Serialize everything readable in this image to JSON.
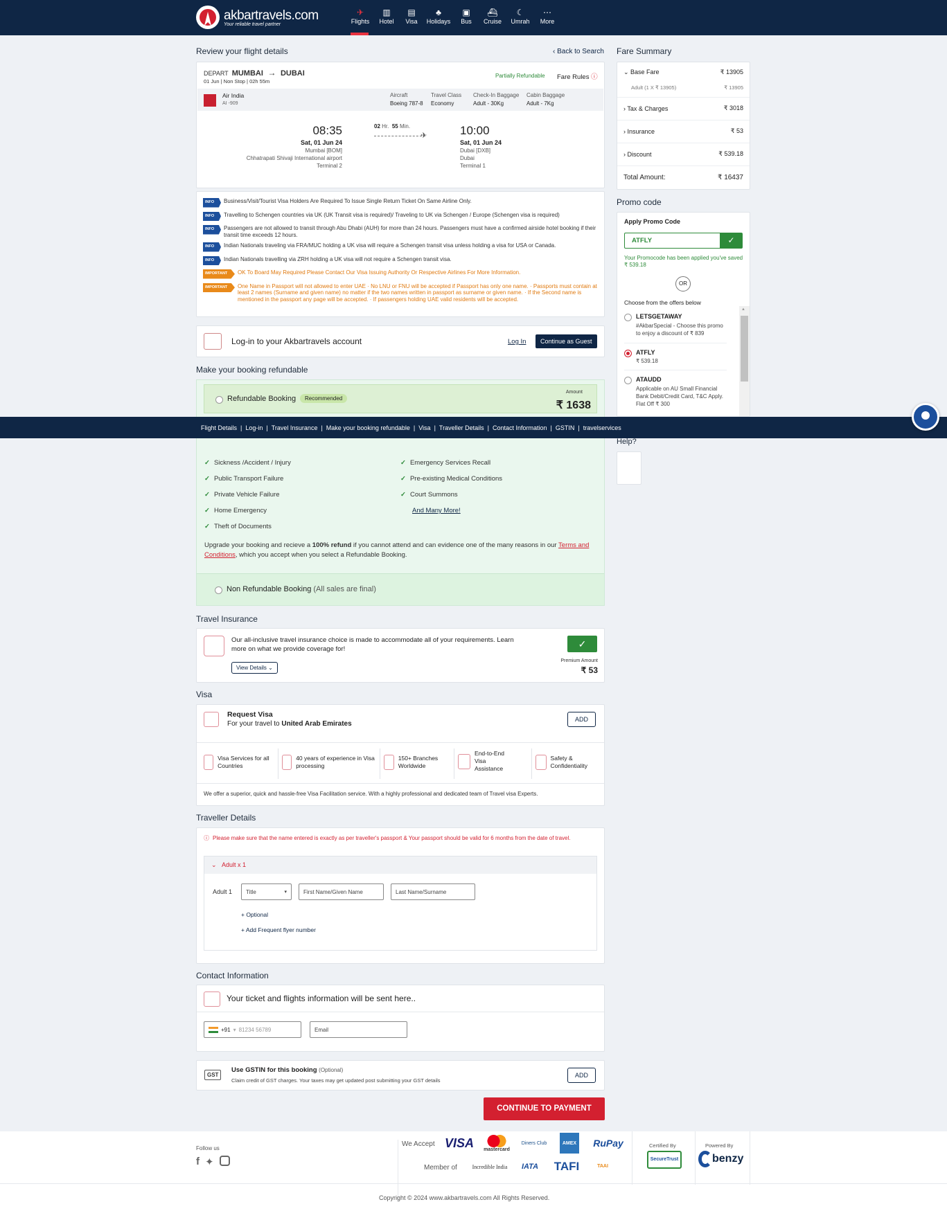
{
  "brand": {
    "name": "akbartravels.com",
    "tagline": "Your reliable travel partner"
  },
  "nav": [
    {
      "label": "Flights",
      "icon": "plane-icon",
      "glyph": "✈"
    },
    {
      "label": "Hotel",
      "icon": "hotel-icon",
      "glyph": "▥"
    },
    {
      "label": "Visa",
      "icon": "visa-icon",
      "glyph": "▤"
    },
    {
      "label": "Holidays",
      "icon": "holidays-icon",
      "glyph": "♣"
    },
    {
      "label": "Bus",
      "icon": "bus-icon",
      "glyph": "▣"
    },
    {
      "label": "Cruise",
      "icon": "cruise-icon",
      "glyph": "⛴"
    },
    {
      "label": "Umrah",
      "icon": "moon-icon",
      "glyph": "☾"
    },
    {
      "label": "More",
      "icon": "more-icon",
      "glyph": "⋯"
    }
  ],
  "review": {
    "title": "Review your flight details",
    "back": "Back to Search"
  },
  "flight": {
    "depart_label": "DEPART",
    "from": "MUMBAI",
    "to": "DUBAI",
    "date": "01 Jun",
    "stops": "Non Stop",
    "duration": "02h 55m",
    "refund_status": "Partially Refundable",
    "fare_rules": "Fare Rules",
    "airline": "Air India",
    "flight_no": "AI -909",
    "aircraft_label": "Aircraft",
    "aircraft": "Boeing 787-8",
    "class_label": "Travel Class",
    "class": "Economy",
    "checkin_label": "Check-In Baggage",
    "checkin": "Adult - 30Kg",
    "cabin_label": "Cabin Baggage",
    "cabin": "Adult - 7Kg",
    "dep_time": "08:35",
    "dep_date": "Sat, 01 Jun 24",
    "dep_city": "Mumbai [BOM]",
    "dep_airport": "Chhatrapati Shivaji International airport",
    "dep_terminal": "Terminal 2",
    "dur_hr": "02",
    "dur_hr_unit": "Hr.",
    "dur_min": "55",
    "dur_min_unit": "Min.",
    "arr_time": "10:00",
    "arr_date": "Sat, 01 Jun 24",
    "arr_city": "Dubai [DXB]",
    "arr_airport": "Dubai",
    "arr_terminal": "Terminal 1"
  },
  "notices": [
    {
      "tag": "INFO",
      "text": "Business/Visit/Tourist Visa Holders Are Required To Issue Single Return Ticket On Same Airline Only."
    },
    {
      "tag": "INFO",
      "text": "Travelling to Schengen countries via UK (UK Transit visa is required)/ Traveling to UK via Schengen / Europe (Schengen visa is required)"
    },
    {
      "tag": "INFO",
      "text": "Passengers are not allowed to transit through Abu Dhabi (AUH) for more than 24 hours. Passengers must have a confirmed airside hotel booking if their transit time exceeds 12 hours."
    },
    {
      "tag": "INFO",
      "text": "Indian Nationals traveling via FRA/MUC holding a UK visa will require a Schengen transit visa unless holding a visa for USA or Canada."
    },
    {
      "tag": "INFO",
      "text": "Indian Nationals travelling via ZRH holding a UK visa will not require a Schengen transit visa."
    },
    {
      "tag": "IMPORTANT",
      "text": "OK To Board May Required Please Contact Our Visa Issuing Authority Or Respective Airlines For More Information."
    },
    {
      "tag": "IMPORTANT",
      "text": "One Name in Passport will not allowed to enter UAE · No LNU or FNU will be accepted if Passport has only one name. · Passports must contain at least 2 names (Surname and given name) no matter if the two names written in passport as surname or given name. · If the Second name is mentioned in the passport any page will be accepted. · If passengers holding UAE valid residents will be accepted."
    }
  ],
  "login": {
    "text": "Log-in to your Akbartravels account",
    "login": "Log In",
    "guest": "Continue as Guest"
  },
  "refund": {
    "title": "Make your booking refundable",
    "option": "Refundable Booking",
    "badge": "Recommended",
    "amount_label": "Amount",
    "amount": "₹ 1638",
    "covers_left": [
      "Sickness /Accident / Injury",
      "Public Transport Failure",
      "Private Vehicle Failure",
      "Home Emergency",
      "Theft of Documents"
    ],
    "covers_right": [
      "Emergency Services Recall",
      "Pre-existing Medical Conditions",
      "Court Summons"
    ],
    "more": "And Many More!",
    "desc_1": "Upgrade your booking and recieve a ",
    "desc_bold": "100% refund",
    "desc_2": " if you cannot attend and can evidence one of the many reasons in our ",
    "terms": "Terms and Conditions",
    "desc_3": ", which you accept when you select a Refundable Booking.",
    "non_option": "Non Refundable Booking",
    "non_note": "(All sales are final)"
  },
  "subnav": [
    "Flight Details",
    "Log-in",
    "Travel Insurance",
    "Make your booking refundable",
    "Visa",
    "Traveller Details",
    "Contact Information",
    "GSTIN",
    "travelservices"
  ],
  "insurance": {
    "title": "Travel Insurance",
    "text": "Our all-inclusive travel insurance choice is made to accommodate all of your requirements. Learn more on what we provide coverage for!",
    "details": "View Details",
    "premium_label": "Premium Amount",
    "premium": "₹ 53"
  },
  "visa": {
    "title": "Visa",
    "request": "Request Visa",
    "for_text": "For your travel to ",
    "country": "United Arab Emirates",
    "add": "ADD",
    "features": [
      "Visa Services for all Countries",
      "40 years of experience in Visa processing",
      "150+ Branches Worldwide",
      "End-to-End Visa Assistance",
      "Safety & Confidentiality"
    ],
    "footer": "We offer a superior, quick and hassle-free Visa Facilitation service. With a highly professional and dedicated team of Travel visa Experts."
  },
  "traveller": {
    "title": "Traveller Details",
    "warning": "Please make sure that the name entered is exactly as per traveller's passport & Your passport should be valid for 6 months from the date of travel.",
    "group": "Adult x 1",
    "adult": "Adult 1",
    "title_ph": "Title",
    "first_ph": "First Name/Given Name",
    "last_ph": "Last Name/Surname",
    "optional": "+ Optional",
    "frequent": "+ Add Frequent flyer number"
  },
  "contact": {
    "title": "Contact Information",
    "text": "Your ticket and flights information will be sent here..",
    "code": "+91",
    "phone_ph": "81234 56789",
    "email_ph": "Email"
  },
  "gst": {
    "label": "GST",
    "title": "Use GSTIN for this booking",
    "optional": "(Optional)",
    "desc": "Claim credit of GST charges. Your taxes may get updated post submitting your GST details",
    "add": "ADD"
  },
  "cta": "CONTINUE TO PAYMENT",
  "fare": {
    "title": "Fare Summary",
    "base_label": "Base Fare",
    "base": "₹ 13905",
    "adult_label": "Adult (1 X ₹ 13905)",
    "adult": "₹ 13905",
    "tax_label": "Tax & Charges",
    "tax": "₹ 3018",
    "ins_label": "Insurance",
    "ins": "₹ 53",
    "disc_label": "Discount",
    "disc": "₹ 539.18",
    "total_label": "Total Amount:",
    "total": "₹ 16437"
  },
  "promo": {
    "title": "Promo code",
    "apply": "Apply Promo Code",
    "code": "ATFLY",
    "applied": "Your Promocode has been applied you've saved ₹ 539.18",
    "or": "OR",
    "choose": "Choose from the offers below",
    "offers": [
      {
        "code": "LETSGETAWAY",
        "desc": "#AkbarSpecial - Choose this promo to enjoy a discount of ₹ 839"
      },
      {
        "code": "ATFLY",
        "desc": "₹ 539.18"
      },
      {
        "code": "ATAUDD",
        "desc": "Applicable on AU Small Financial Bank Debit/Credit Card, T&C Apply. Flat Off ₹ 300"
      }
    ]
  },
  "help": "Help?",
  "footer": {
    "follow": "Follow us",
    "we_accept": "We Accept",
    "member_of": "Member of",
    "certified": "Certified By",
    "powered": "Powered By",
    "cards": [
      "VISA",
      "mastercard",
      "Diners Club",
      "AMEX",
      "RuPay"
    ],
    "members": [
      "Incredible India",
      "IATA",
      "TAFI",
      "TAAI"
    ],
    "secure": "SecureTrust",
    "benzy": "benzy",
    "copyright": "Copyright © 2024 www.akbartravels.com All Rights Reserved."
  },
  "colors": {
    "navy": "#0f2645",
    "red": "#d32030",
    "green": "#2e8b3a"
  }
}
